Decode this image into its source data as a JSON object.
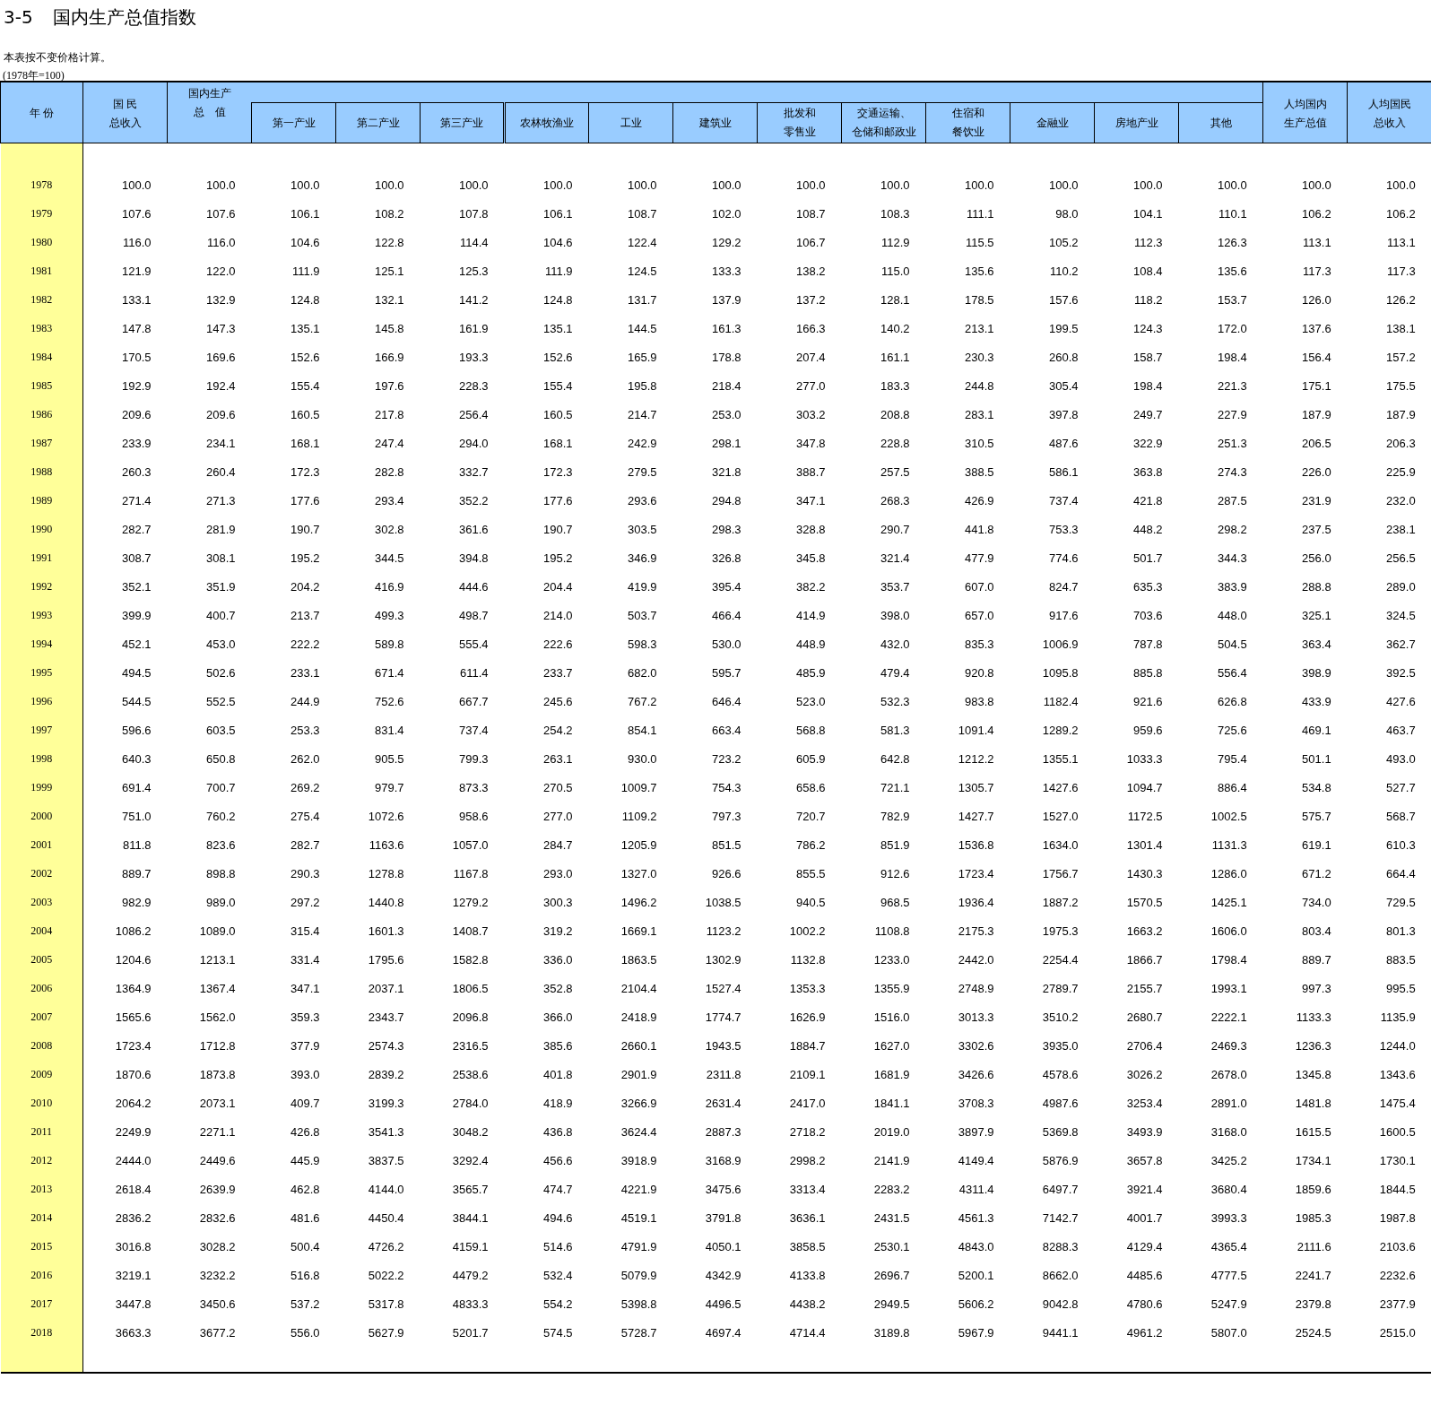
{
  "table_number": "3-5",
  "title": "国内生产总值指数",
  "note": "本表按不变价格计算。",
  "unit": "(1978年=100)",
  "header": {
    "year": "年 份",
    "columns": [
      {
        "kind": "top",
        "lines": [
          "国 民",
          "总收入"
        ]
      },
      {
        "kind": "top",
        "lines": [
          "国内生产",
          "总　值"
        ]
      },
      {
        "kind": "sub",
        "text": "第一产业"
      },
      {
        "kind": "sub",
        "text": "第二产业"
      },
      {
        "kind": "sub",
        "text": "第三产业"
      },
      {
        "kind": "sub",
        "text": "农林牧渔业"
      },
      {
        "kind": "sub",
        "text": "工业"
      },
      {
        "kind": "sub",
        "text": "建筑业"
      },
      {
        "kind": "sub",
        "lines": [
          "批发和",
          "零售业"
        ]
      },
      {
        "kind": "sub",
        "lines": [
          "交通运输、",
          "仓储和邮政业"
        ]
      },
      {
        "kind": "sub",
        "lines": [
          "住宿和",
          "餐饮业"
        ]
      },
      {
        "kind": "sub",
        "text": "金融业"
      },
      {
        "kind": "sub",
        "text": "房地产业"
      },
      {
        "kind": "sub",
        "text": "其他"
      },
      {
        "kind": "top",
        "lines": [
          "人均国内",
          "生产总值"
        ]
      },
      {
        "kind": "top",
        "lines": [
          "人均国民",
          "总收入"
        ]
      }
    ]
  },
  "rows": [
    {
      "year": "1978",
      "values": [
        "100.0",
        "100.0",
        "100.0",
        "100.0",
        "100.0",
        "100.0",
        "100.0",
        "100.0",
        "100.0",
        "100.0",
        "100.0",
        "100.0",
        "100.0",
        "100.0",
        "100.0",
        "100.0"
      ]
    },
    {
      "year": "1979",
      "values": [
        "107.6",
        "107.6",
        "106.1",
        "108.2",
        "107.8",
        "106.1",
        "108.7",
        "102.0",
        "108.7",
        "108.3",
        "111.1",
        "98.0",
        "104.1",
        "110.1",
        "106.2",
        "106.2"
      ]
    },
    {
      "year": "1980",
      "values": [
        "116.0",
        "116.0",
        "104.6",
        "122.8",
        "114.4",
        "104.6",
        "122.4",
        "129.2",
        "106.7",
        "112.9",
        "115.5",
        "105.2",
        "112.3",
        "126.3",
        "113.1",
        "113.1"
      ]
    },
    {
      "year": "1981",
      "values": [
        "121.9",
        "122.0",
        "111.9",
        "125.1",
        "125.3",
        "111.9",
        "124.5",
        "133.3",
        "138.2",
        "115.0",
        "135.6",
        "110.2",
        "108.4",
        "135.6",
        "117.3",
        "117.3"
      ]
    },
    {
      "year": "1982",
      "values": [
        "133.1",
        "132.9",
        "124.8",
        "132.1",
        "141.2",
        "124.8",
        "131.7",
        "137.9",
        "137.2",
        "128.1",
        "178.5",
        "157.6",
        "118.2",
        "153.7",
        "126.0",
        "126.2"
      ]
    },
    {
      "year": "1983",
      "values": [
        "147.8",
        "147.3",
        "135.1",
        "145.8",
        "161.9",
        "135.1",
        "144.5",
        "161.3",
        "166.3",
        "140.2",
        "213.1",
        "199.5",
        "124.3",
        "172.0",
        "137.6",
        "138.1"
      ]
    },
    {
      "year": "1984",
      "values": [
        "170.5",
        "169.6",
        "152.6",
        "166.9",
        "193.3",
        "152.6",
        "165.9",
        "178.8",
        "207.4",
        "161.1",
        "230.3",
        "260.8",
        "158.7",
        "198.4",
        "156.4",
        "157.2"
      ]
    },
    {
      "year": "1985",
      "values": [
        "192.9",
        "192.4",
        "155.4",
        "197.6",
        "228.3",
        "155.4",
        "195.8",
        "218.4",
        "277.0",
        "183.3",
        "244.8",
        "305.4",
        "198.4",
        "221.3",
        "175.1",
        "175.5"
      ]
    },
    {
      "year": "1986",
      "values": [
        "209.6",
        "209.6",
        "160.5",
        "217.8",
        "256.4",
        "160.5",
        "214.7",
        "253.0",
        "303.2",
        "208.8",
        "283.1",
        "397.8",
        "249.7",
        "227.9",
        "187.9",
        "187.9"
      ]
    },
    {
      "year": "1987",
      "values": [
        "233.9",
        "234.1",
        "168.1",
        "247.4",
        "294.0",
        "168.1",
        "242.9",
        "298.1",
        "347.8",
        "228.8",
        "310.5",
        "487.6",
        "322.9",
        "251.3",
        "206.5",
        "206.3"
      ]
    },
    {
      "year": "1988",
      "values": [
        "260.3",
        "260.4",
        "172.3",
        "282.8",
        "332.7",
        "172.3",
        "279.5",
        "321.8",
        "388.7",
        "257.5",
        "388.5",
        "586.1",
        "363.8",
        "274.3",
        "226.0",
        "225.9"
      ]
    },
    {
      "year": "1989",
      "values": [
        "271.4",
        "271.3",
        "177.6",
        "293.4",
        "352.2",
        "177.6",
        "293.6",
        "294.8",
        "347.1",
        "268.3",
        "426.9",
        "737.4",
        "421.8",
        "287.5",
        "231.9",
        "232.0"
      ]
    },
    {
      "year": "1990",
      "values": [
        "282.7",
        "281.9",
        "190.7",
        "302.8",
        "361.6",
        "190.7",
        "303.5",
        "298.3",
        "328.8",
        "290.7",
        "441.8",
        "753.3",
        "448.2",
        "298.2",
        "237.5",
        "238.1"
      ]
    },
    {
      "year": "1991",
      "values": [
        "308.7",
        "308.1",
        "195.2",
        "344.5",
        "394.8",
        "195.2",
        "346.9",
        "326.8",
        "345.8",
        "321.4",
        "477.9",
        "774.6",
        "501.7",
        "344.3",
        "256.0",
        "256.5"
      ]
    },
    {
      "year": "1992",
      "values": [
        "352.1",
        "351.9",
        "204.2",
        "416.9",
        "444.6",
        "204.4",
        "419.9",
        "395.4",
        "382.2",
        "353.7",
        "607.0",
        "824.7",
        "635.3",
        "383.9",
        "288.8",
        "289.0"
      ]
    },
    {
      "year": "1993",
      "values": [
        "399.9",
        "400.7",
        "213.7",
        "499.3",
        "498.7",
        "214.0",
        "503.7",
        "466.4",
        "414.9",
        "398.0",
        "657.0",
        "917.6",
        "703.6",
        "448.0",
        "325.1",
        "324.5"
      ]
    },
    {
      "year": "1994",
      "values": [
        "452.1",
        "453.0",
        "222.2",
        "589.8",
        "555.4",
        "222.6",
        "598.3",
        "530.0",
        "448.9",
        "432.0",
        "835.3",
        "1006.9",
        "787.8",
        "504.5",
        "363.4",
        "362.7"
      ]
    },
    {
      "year": "1995",
      "values": [
        "494.5",
        "502.6",
        "233.1",
        "671.4",
        "611.4",
        "233.7",
        "682.0",
        "595.7",
        "485.9",
        "479.4",
        "920.8",
        "1095.8",
        "885.8",
        "556.4",
        "398.9",
        "392.5"
      ]
    },
    {
      "year": "1996",
      "values": [
        "544.5",
        "552.5",
        "244.9",
        "752.6",
        "667.7",
        "245.6",
        "767.2",
        "646.4",
        "523.0",
        "532.3",
        "983.8",
        "1182.4",
        "921.6",
        "626.8",
        "433.9",
        "427.6"
      ]
    },
    {
      "year": "1997",
      "values": [
        "596.6",
        "603.5",
        "253.3",
        "831.4",
        "737.4",
        "254.2",
        "854.1",
        "663.4",
        "568.8",
        "581.3",
        "1091.4",
        "1289.2",
        "959.6",
        "725.6",
        "469.1",
        "463.7"
      ]
    },
    {
      "year": "1998",
      "values": [
        "640.3",
        "650.8",
        "262.0",
        "905.5",
        "799.3",
        "263.1",
        "930.0",
        "723.2",
        "605.9",
        "642.8",
        "1212.2",
        "1355.1",
        "1033.3",
        "795.4",
        "501.1",
        "493.0"
      ]
    },
    {
      "year": "1999",
      "values": [
        "691.4",
        "700.7",
        "269.2",
        "979.7",
        "873.3",
        "270.5",
        "1009.7",
        "754.3",
        "658.6",
        "721.1",
        "1305.7",
        "1427.6",
        "1094.7",
        "886.4",
        "534.8",
        "527.7"
      ]
    },
    {
      "year": "2000",
      "values": [
        "751.0",
        "760.2",
        "275.4",
        "1072.6",
        "958.6",
        "277.0",
        "1109.2",
        "797.3",
        "720.7",
        "782.9",
        "1427.7",
        "1527.0",
        "1172.5",
        "1002.5",
        "575.7",
        "568.7"
      ]
    },
    {
      "year": "2001",
      "values": [
        "811.8",
        "823.6",
        "282.7",
        "1163.6",
        "1057.0",
        "284.7",
        "1205.9",
        "851.5",
        "786.2",
        "851.9",
        "1536.8",
        "1634.0",
        "1301.4",
        "1131.3",
        "619.1",
        "610.3"
      ]
    },
    {
      "year": "2002",
      "values": [
        "889.7",
        "898.8",
        "290.3",
        "1278.8",
        "1167.8",
        "293.0",
        "1327.0",
        "926.6",
        "855.5",
        "912.6",
        "1723.4",
        "1756.7",
        "1430.3",
        "1286.0",
        "671.2",
        "664.4"
      ]
    },
    {
      "year": "2003",
      "values": [
        "982.9",
        "989.0",
        "297.2",
        "1440.8",
        "1279.2",
        "300.3",
        "1496.2",
        "1038.5",
        "940.5",
        "968.5",
        "1936.4",
        "1887.2",
        "1570.5",
        "1425.1",
        "734.0",
        "729.5"
      ]
    },
    {
      "year": "2004",
      "values": [
        "1086.2",
        "1089.0",
        "315.4",
        "1601.3",
        "1408.7",
        "319.2",
        "1669.1",
        "1123.2",
        "1002.2",
        "1108.8",
        "2175.3",
        "1975.3",
        "1663.2",
        "1606.0",
        "803.4",
        "801.3"
      ]
    },
    {
      "year": "2005",
      "values": [
        "1204.6",
        "1213.1",
        "331.4",
        "1795.6",
        "1582.8",
        "336.0",
        "1863.5",
        "1302.9",
        "1132.8",
        "1233.0",
        "2442.0",
        "2254.4",
        "1866.7",
        "1798.4",
        "889.7",
        "883.5"
      ]
    },
    {
      "year": "2006",
      "values": [
        "1364.9",
        "1367.4",
        "347.1",
        "2037.1",
        "1806.5",
        "352.8",
        "2104.4",
        "1527.4",
        "1353.3",
        "1355.9",
        "2748.9",
        "2789.7",
        "2155.7",
        "1993.1",
        "997.3",
        "995.5"
      ]
    },
    {
      "year": "2007",
      "values": [
        "1565.6",
        "1562.0",
        "359.3",
        "2343.7",
        "2096.8",
        "366.0",
        "2418.9",
        "1774.7",
        "1626.9",
        "1516.0",
        "3013.3",
        "3510.2",
        "2680.7",
        "2222.1",
        "1133.3",
        "1135.9"
      ]
    },
    {
      "year": "2008",
      "values": [
        "1723.4",
        "1712.8",
        "377.9",
        "2574.3",
        "2316.5",
        "385.6",
        "2660.1",
        "1943.5",
        "1884.7",
        "1627.0",
        "3302.6",
        "3935.0",
        "2706.4",
        "2469.3",
        "1236.3",
        "1244.0"
      ]
    },
    {
      "year": "2009",
      "values": [
        "1870.6",
        "1873.8",
        "393.0",
        "2839.2",
        "2538.6",
        "401.8",
        "2901.9",
        "2311.8",
        "2109.1",
        "1681.9",
        "3426.6",
        "4578.6",
        "3026.2",
        "2678.0",
        "1345.8",
        "1343.6"
      ]
    },
    {
      "year": "2010",
      "values": [
        "2064.2",
        "2073.1",
        "409.7",
        "3199.3",
        "2784.0",
        "418.9",
        "3266.9",
        "2631.4",
        "2417.0",
        "1841.1",
        "3708.3",
        "4987.6",
        "3253.4",
        "2891.0",
        "1481.8",
        "1475.4"
      ]
    },
    {
      "year": "2011",
      "values": [
        "2249.9",
        "2271.1",
        "426.8",
        "3541.3",
        "3048.2",
        "436.8",
        "3624.4",
        "2887.3",
        "2718.2",
        "2019.0",
        "3897.9",
        "5369.8",
        "3493.9",
        "3168.0",
        "1615.5",
        "1600.5"
      ]
    },
    {
      "year": "2012",
      "values": [
        "2444.0",
        "2449.6",
        "445.9",
        "3837.5",
        "3292.4",
        "456.6",
        "3918.9",
        "3168.9",
        "2998.2",
        "2141.9",
        "4149.4",
        "5876.9",
        "3657.8",
        "3425.2",
        "1734.1",
        "1730.1"
      ]
    },
    {
      "year": "2013",
      "values": [
        "2618.4",
        "2639.9",
        "462.8",
        "4144.0",
        "3565.7",
        "474.7",
        "4221.9",
        "3475.6",
        "3313.4",
        "2283.2",
        "4311.4",
        "6497.7",
        "3921.4",
        "3680.4",
        "1859.6",
        "1844.5"
      ]
    },
    {
      "year": "2014",
      "values": [
        "2836.2",
        "2832.6",
        "481.6",
        "4450.4",
        "3844.1",
        "494.6",
        "4519.1",
        "3791.8",
        "3636.1",
        "2431.5",
        "4561.3",
        "7142.7",
        "4001.7",
        "3993.3",
        "1985.3",
        "1987.8"
      ]
    },
    {
      "year": "2015",
      "values": [
        "3016.8",
        "3028.2",
        "500.4",
        "4726.2",
        "4159.1",
        "514.6",
        "4791.9",
        "4050.1",
        "3858.5",
        "2530.1",
        "4843.0",
        "8288.3",
        "4129.4",
        "4365.4",
        "2111.6",
        "2103.6"
      ]
    },
    {
      "year": "2016",
      "values": [
        "3219.1",
        "3232.2",
        "516.8",
        "5022.2",
        "4479.2",
        "532.4",
        "5079.9",
        "4342.9",
        "4133.8",
        "2696.7",
        "5200.1",
        "8662.0",
        "4485.6",
        "4777.5",
        "2241.7",
        "2232.6"
      ]
    },
    {
      "year": "2017",
      "values": [
        "3447.8",
        "3450.6",
        "537.2",
        "5317.8",
        "4833.3",
        "554.2",
        "5398.8",
        "4496.5",
        "4438.2",
        "2949.5",
        "5606.2",
        "9042.8",
        "4780.6",
        "5247.9",
        "2379.8",
        "2377.9"
      ]
    },
    {
      "year": "2018",
      "values": [
        "3663.3",
        "3677.2",
        "556.0",
        "5627.9",
        "5201.7",
        "574.5",
        "5728.7",
        "4697.4",
        "4714.4",
        "3189.8",
        "5967.9",
        "9441.1",
        "4961.2",
        "5807.0",
        "2524.5",
        "2515.0"
      ]
    }
  ]
}
